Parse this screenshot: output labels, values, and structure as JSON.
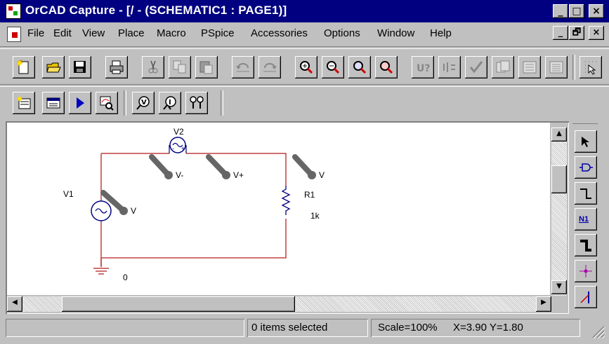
{
  "window": {
    "title": "OrCAD Capture - [/ - (SCHEMATIC1 : PAGE1)]",
    "caption_buttons": [
      "_",
      "□",
      "×"
    ]
  },
  "menubar": {
    "items": [
      "File",
      "Edit",
      "View",
      "Place",
      "Macro",
      "PSpice",
      "Accessories",
      "Options",
      "Window",
      "Help"
    ],
    "mdi_buttons": [
      "_",
      "🗗",
      "×"
    ]
  },
  "toolbar_main": {
    "buttons": [
      "new-document-icon",
      "open-folder-icon",
      "save-icon",
      "print-icon",
      "cut-icon",
      "copy-icon",
      "paste-icon",
      "undo-icon",
      "redo-icon",
      "zoom-in-icon",
      "zoom-out-icon",
      "zoom-area-icon",
      "zoom-all-icon",
      "annotate-icon",
      "back-annotate-icon",
      "design-rules-check-icon",
      "netlist-icon",
      "cross-reference-icon",
      "bill-of-materials-icon",
      "snap-to-grid-icon"
    ]
  },
  "toolbar_pspice": {
    "buttons": [
      "new-simulation-profile-icon",
      "edit-simulation-settings-icon",
      "run-simulation-icon",
      "view-simulation-results-icon",
      "voltage-marker-icon",
      "current-marker-icon",
      "voltage-differential-marker-icon"
    ]
  },
  "schematic": {
    "components": {
      "v1": {
        "ref": "V1"
      },
      "v2": {
        "ref": "V2"
      },
      "r1": {
        "ref": "R1",
        "value": "1k"
      },
      "ground": {
        "label": "0"
      }
    },
    "markers": {
      "v1": "V",
      "v2_minus": "V-",
      "v2_plus": "V+",
      "r1": "V"
    },
    "wire_color": "#c04040",
    "marker_color": "#666666"
  },
  "palette": {
    "tools": [
      "select-pointer-icon",
      "place-part-icon",
      "place-wire-icon",
      "place-net-alias-icon",
      "place-bus-icon",
      "place-junction-icon",
      "place-bus-entry-icon"
    ],
    "net_alias_label": "N1"
  },
  "statusbar": {
    "selection": "0 items selected",
    "scale": "Scale=100%",
    "coords": "X=3.90  Y=1.80"
  },
  "colors": {
    "titlebar": "#000080",
    "chrome": "#c0c0c0"
  }
}
